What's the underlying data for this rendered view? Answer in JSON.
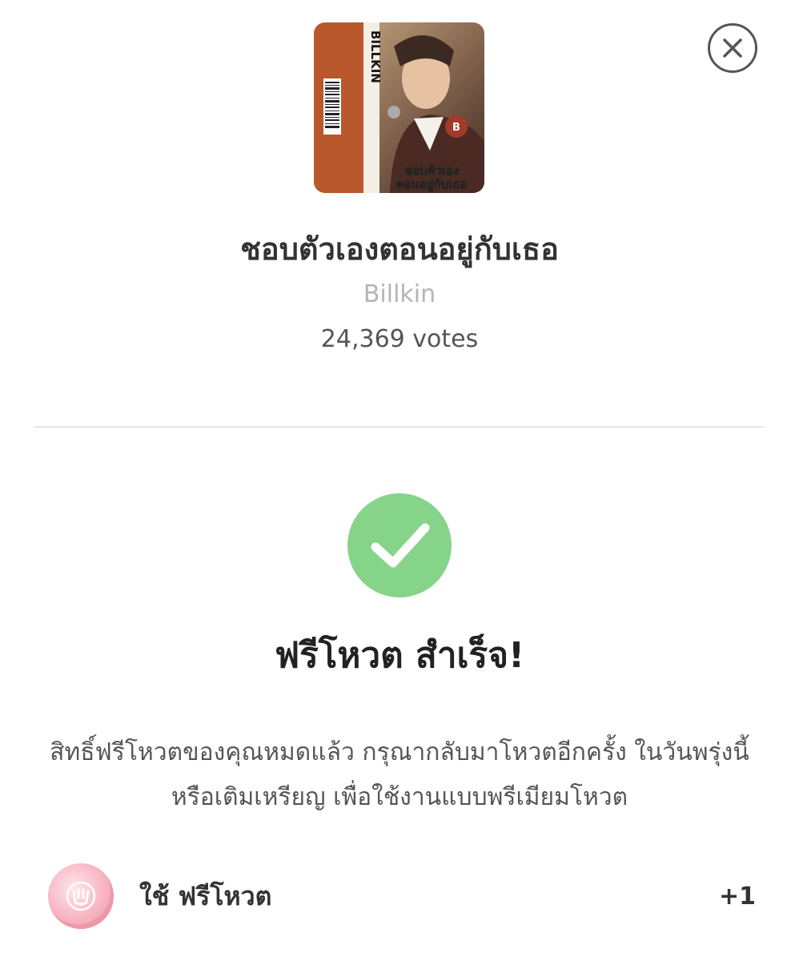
{
  "song": {
    "title": "ชอบตัวเองตอนอยู่กับเธอ",
    "artist": "Billkin",
    "votes": "24,369 votes"
  },
  "cover": {
    "spine_text": "BILLKIN",
    "cover_text_line1": "ชอบตัวเอง",
    "cover_text_line2": "ตอนอยู่กับเธอ",
    "badge_text": "B"
  },
  "status": {
    "title": "ฟรีโหวต สำเร็จ!",
    "message": "สิทธิ์ฟรีโหวตของคุณหมดแล้ว กรุณากลับมาโหวตอีกครั้ง ในวันพรุ่งนี้ หรือเติมเหรียญ เพื่อใช้งานแบบพรีเมียมโหวต"
  },
  "free_vote": {
    "label": "ใช้ ฟรีโหวต",
    "count": "+1"
  },
  "icons": {
    "close": "close-icon",
    "check": "check-icon",
    "coin": "coin-icon"
  },
  "colors": {
    "success": "#86d48a",
    "coin": "#f7b3c0",
    "cover_orange": "#b8582c"
  }
}
